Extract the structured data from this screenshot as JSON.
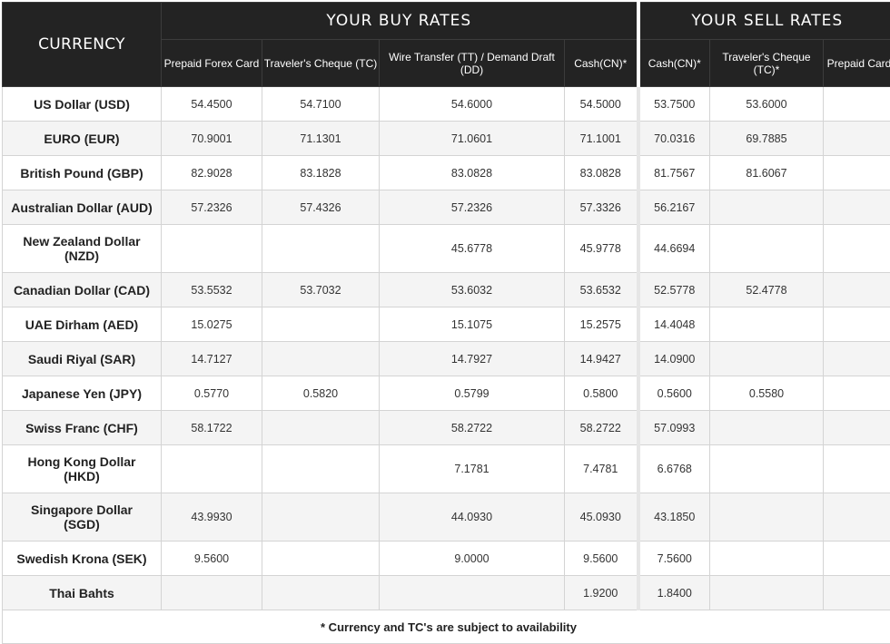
{
  "header": {
    "currency_label": "CURRENCY",
    "buy_title": "YOUR BUY RATES",
    "sell_title": "YOUR SELL RATES",
    "buy_columns": [
      "Prepaid Forex Card",
      "Traveler's Cheque (TC)",
      "Wire Transfer (TT) / Demand Draft (DD)",
      "Cash(CN)*"
    ],
    "sell_columns": [
      "Cash(CN)*",
      "Traveler's Cheque (TC)*",
      "Prepaid Card"
    ]
  },
  "rows": [
    {
      "currency": "US Dollar (USD)",
      "values": [
        "54.4500",
        "54.7100",
        "54.6000",
        "54.5000",
        "53.7500",
        "53.6000",
        ""
      ]
    },
    {
      "currency": "EURO (EUR)",
      "values": [
        "70.9001",
        "71.1301",
        "71.0601",
        "71.1001",
        "70.0316",
        "69.7885",
        ""
      ]
    },
    {
      "currency": "British Pound (GBP)",
      "values": [
        "82.9028",
        "83.1828",
        "83.0828",
        "83.0828",
        "81.7567",
        "81.6067",
        ""
      ]
    },
    {
      "currency": "Australian Dollar (AUD)",
      "values": [
        "57.2326",
        "57.4326",
        "57.2326",
        "57.3326",
        "56.2167",
        "",
        ""
      ]
    },
    {
      "currency": "New Zealand Dollar (NZD)",
      "values": [
        "",
        "",
        "45.6778",
        "45.9778",
        "44.6694",
        "",
        ""
      ]
    },
    {
      "currency": "Canadian Dollar (CAD)",
      "values": [
        "53.5532",
        "53.7032",
        "53.6032",
        "53.6532",
        "52.5778",
        "52.4778",
        ""
      ]
    },
    {
      "currency": "UAE Dirham (AED)",
      "values": [
        "15.0275",
        "",
        "15.1075",
        "15.2575",
        "14.4048",
        "",
        ""
      ]
    },
    {
      "currency": "Saudi Riyal (SAR)",
      "values": [
        "14.7127",
        "",
        "14.7927",
        "14.9427",
        "14.0900",
        "",
        ""
      ]
    },
    {
      "currency": "Japanese Yen (JPY)",
      "values": [
        "0.5770",
        "0.5820",
        "0.5799",
        "0.5800",
        "0.5600",
        "0.5580",
        ""
      ]
    },
    {
      "currency": "Swiss Franc (CHF)",
      "values": [
        "58.1722",
        "",
        "58.2722",
        "58.2722",
        "57.0993",
        "",
        ""
      ]
    },
    {
      "currency": "Hong Kong Dollar (HKD)",
      "values": [
        "",
        "",
        "7.1781",
        "7.4781",
        "6.6768",
        "",
        ""
      ]
    },
    {
      "currency": "Singapore Dollar (SGD)",
      "values": [
        "43.9930",
        "",
        "44.0930",
        "45.0930",
        "43.1850",
        "",
        ""
      ]
    },
    {
      "currency": "Swedish Krona (SEK)",
      "values": [
        "9.5600",
        "",
        "9.0000",
        "9.5600",
        "7.5600",
        "",
        ""
      ]
    },
    {
      "currency": "Thai Bahts",
      "values": [
        "",
        "",
        "",
        "1.9200",
        "1.8400",
        "",
        ""
      ]
    }
  ],
  "footer": {
    "note": "* Currency and TC's are subject to availability"
  }
}
